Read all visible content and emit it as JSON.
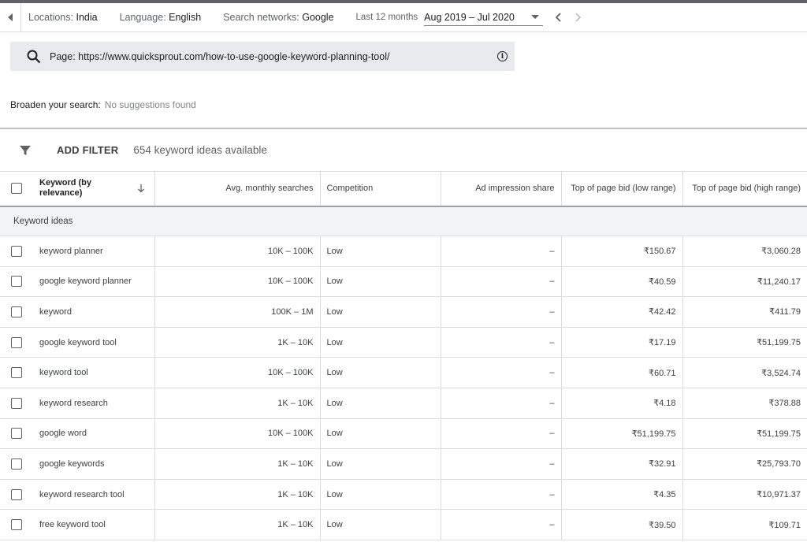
{
  "filters": {
    "location_label": "Locations:",
    "location_value": "India",
    "language_label": "Language:",
    "language_value": "English",
    "network_label": "Search networks:",
    "network_value": "Google",
    "period_label": "Last 12 months",
    "date_range": "Aug 2019 – Jul 2020"
  },
  "search": {
    "query": "Page: https://www.quicksprout.com/how-to-use-google-keyword-planning-tool/",
    "info_icon": "i"
  },
  "broaden": {
    "label": "Broaden your search:",
    "value": "No suggestions found"
  },
  "toolbar": {
    "add_filter": "ADD FILTER",
    "count_text": "654 keyword ideas available"
  },
  "table": {
    "headers": {
      "keyword": "Keyword (by relevance)",
      "avg": "Avg. monthly searches",
      "competition": "Competition",
      "ad_share": "Ad impression share",
      "bid_low": "Top of page bid (low range)",
      "bid_high": "Top of page bid (high range)"
    },
    "group_label": "Keyword ideas",
    "rows": [
      {
        "keyword": "keyword planner",
        "avg": "10K – 100K",
        "competition": "Low",
        "ad_share": "–",
        "bid_low": "₹150.67",
        "bid_high": "₹3,060.28"
      },
      {
        "keyword": "google keyword planner",
        "avg": "10K – 100K",
        "competition": "Low",
        "ad_share": "–",
        "bid_low": "₹40.59",
        "bid_high": "₹11,240.17"
      },
      {
        "keyword": "keyword",
        "avg": "100K – 1M",
        "competition": "Low",
        "ad_share": "–",
        "bid_low": "₹42.42",
        "bid_high": "₹411.79"
      },
      {
        "keyword": "google keyword tool",
        "avg": "1K – 10K",
        "competition": "Low",
        "ad_share": "–",
        "bid_low": "₹17.19",
        "bid_high": "₹51,199.75"
      },
      {
        "keyword": "keyword tool",
        "avg": "10K – 100K",
        "competition": "Low",
        "ad_share": "–",
        "bid_low": "₹60.71",
        "bid_high": "₹3,524.74"
      },
      {
        "keyword": "keyword research",
        "avg": "1K – 10K",
        "competition": "Low",
        "ad_share": "–",
        "bid_low": "₹4.18",
        "bid_high": "₹378.88"
      },
      {
        "keyword": "google word",
        "avg": "10K – 100K",
        "competition": "Low",
        "ad_share": "–",
        "bid_low": "₹51,199.75",
        "bid_high": "₹51,199.75"
      },
      {
        "keyword": "google keywords",
        "avg": "1K – 10K",
        "competition": "Low",
        "ad_share": "–",
        "bid_low": "₹32.91",
        "bid_high": "₹25,793.70"
      },
      {
        "keyword": "keyword research tool",
        "avg": "1K – 10K",
        "competition": "Low",
        "ad_share": "–",
        "bid_low": "₹4.35",
        "bid_high": "₹10,971.37"
      },
      {
        "keyword": "free keyword tool",
        "avg": "1K – 10K",
        "competition": "Low",
        "ad_share": "–",
        "bid_low": "₹39.50",
        "bid_high": "₹109.71"
      }
    ]
  },
  "icons": {
    "back": "back-triangle-icon",
    "search": "search-icon",
    "info": "info-icon",
    "funnel": "filter-funnel-icon",
    "sort": "arrow-down-icon",
    "prev": "chevron-left-icon",
    "next": "chevron-right-icon",
    "dropdown": "caret-down-icon"
  }
}
